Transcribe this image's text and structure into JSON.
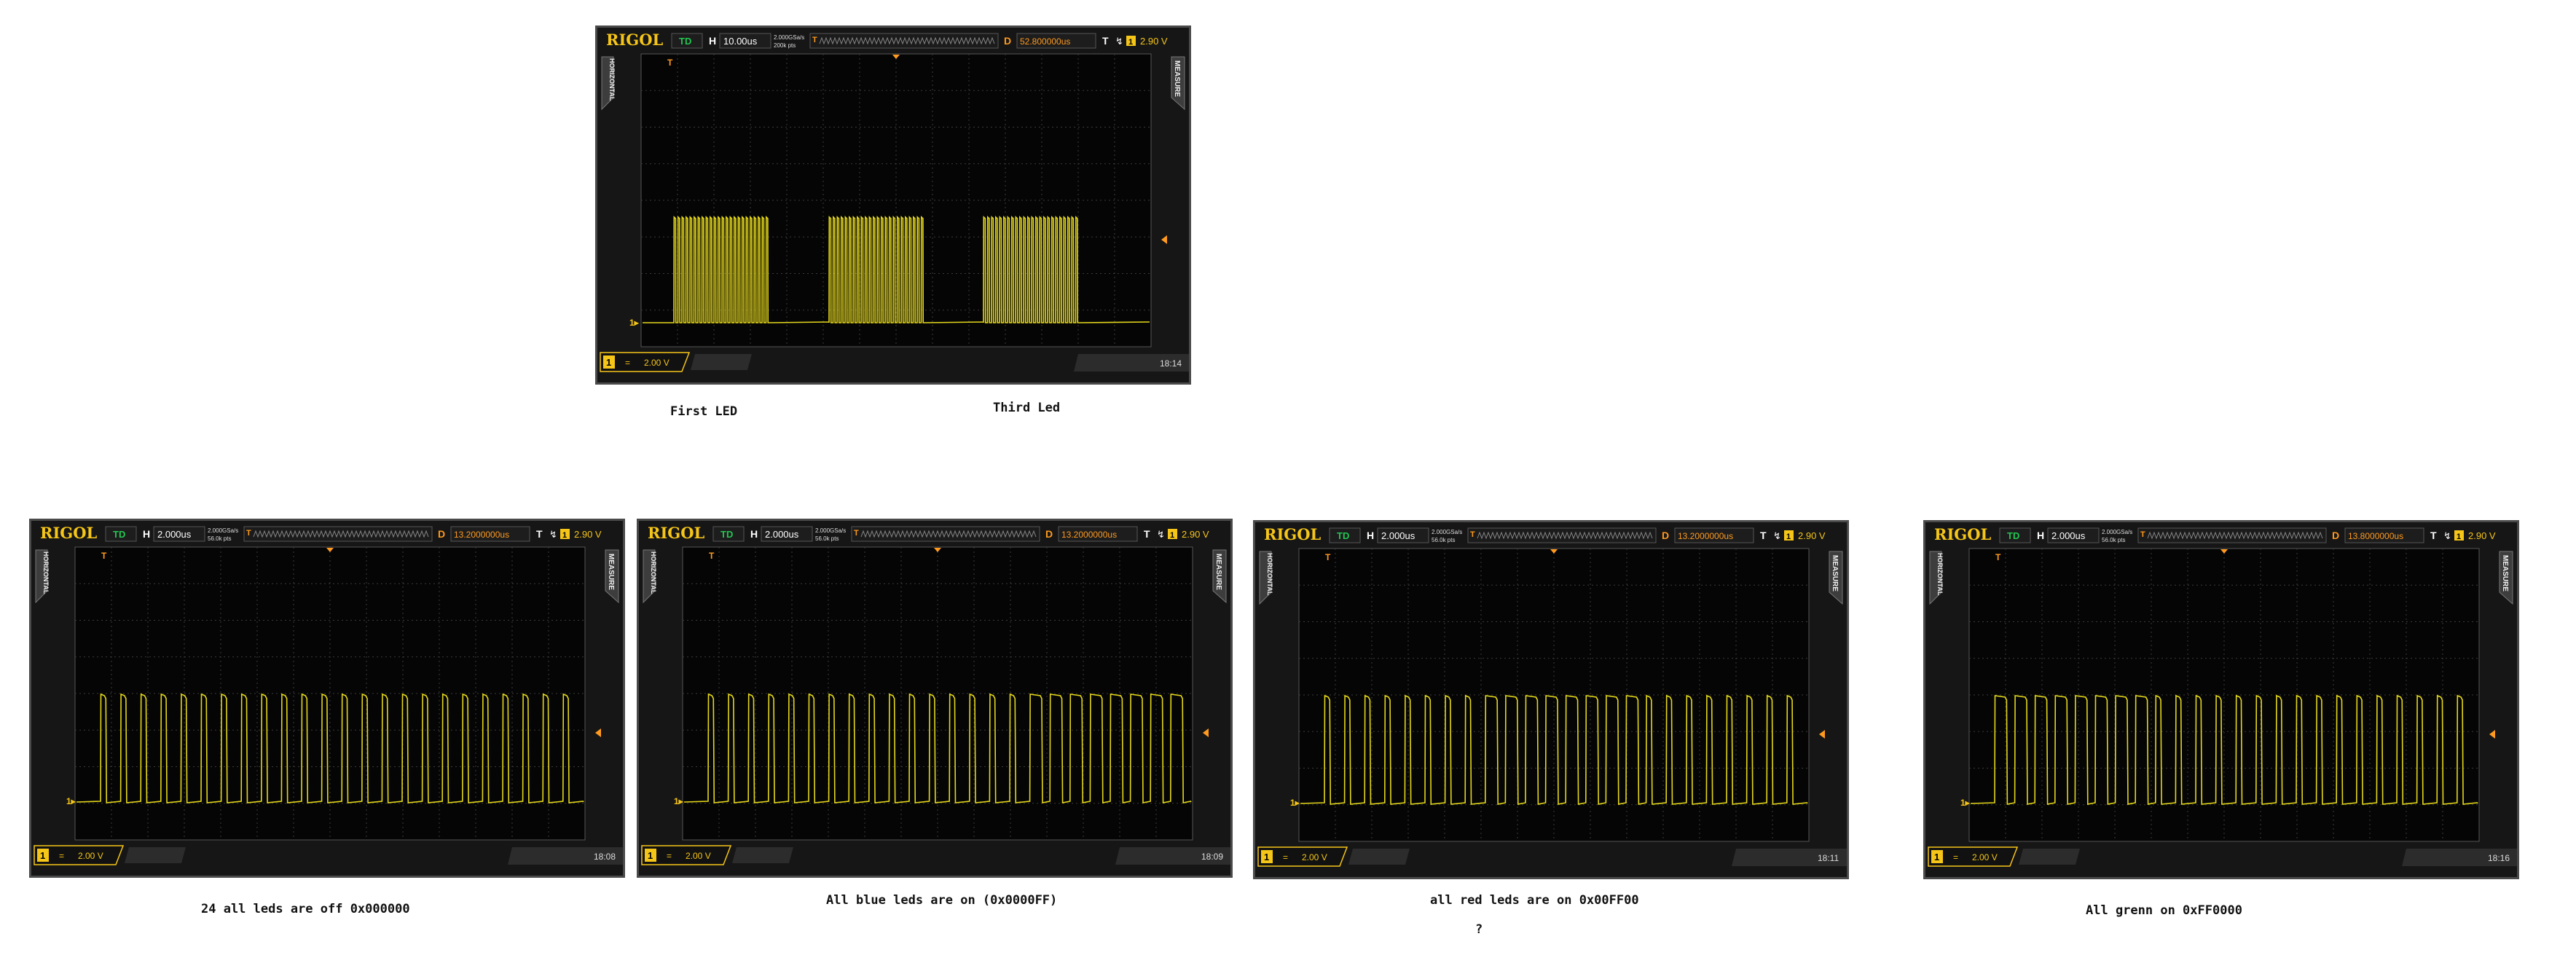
{
  "colors": {
    "trace": "#e5d81b",
    "brand": "#f5c518",
    "td": "#23c552",
    "delay": "#ff9a1f",
    "grid": "#3b3b3b",
    "panel": "#2a2a2a",
    "screen": "#050505"
  },
  "scopes": [
    {
      "brand": "RIGOL",
      "td": "TD",
      "h_label": "H",
      "timebase": "10.00us",
      "sample_rate": "2.000GSa/s",
      "mem_depth": "200k pts",
      "d_label": "D",
      "delay": "52.800000us",
      "t_label": "T",
      "channel": "1",
      "trigger_level": "2.90 V",
      "left_tab": "HORIZONTAL",
      "right_tab": "MEASURE",
      "ch_scale": "2.00 V",
      "ch_marker": "1",
      "coupling": "=",
      "time": "18:14",
      "pattern": "groups",
      "groups": 3,
      "pulses_per_group": 24
    },
    {
      "brand": "RIGOL",
      "td": "TD",
      "h_label": "H",
      "timebase": "2.000us",
      "sample_rate": "2.000GSa/s",
      "mem_depth": "56.0k pts",
      "d_label": "D",
      "delay": "13.2000000us",
      "t_label": "T",
      "channel": "1",
      "trigger_level": "2.90 V",
      "left_tab": "HORIZONTAL",
      "right_tab": "MEASURE",
      "ch_scale": "2.00 V",
      "ch_marker": "1",
      "coupling": "=",
      "time": "18:08",
      "pattern": "bits",
      "bits": "000000000000000000000000"
    },
    {
      "brand": "RIGOL",
      "td": "TD",
      "h_label": "H",
      "timebase": "2.000us",
      "sample_rate": "2.000GSa/s",
      "mem_depth": "56.0k pts",
      "d_label": "D",
      "delay": "13.2000000us",
      "t_label": "T",
      "channel": "1",
      "trigger_level": "2.90 V",
      "left_tab": "HORIZONTAL",
      "right_tab": "MEASURE",
      "ch_scale": "2.00 V",
      "ch_marker": "1",
      "coupling": "=",
      "time": "18:09",
      "pattern": "bits",
      "bits": "000000000000000011111111"
    },
    {
      "brand": "RIGOL",
      "td": "TD",
      "h_label": "H",
      "timebase": "2.000us",
      "sample_rate": "2.000GSa/s",
      "mem_depth": "56.0k pts",
      "d_label": "D",
      "delay": "13.2000000us",
      "t_label": "T",
      "channel": "1",
      "trigger_level": "2.90 V",
      "left_tab": "HORIZONTAL",
      "right_tab": "MEASURE",
      "ch_scale": "2.00 V",
      "ch_marker": "1",
      "coupling": "=",
      "time": "18:11",
      "pattern": "bits",
      "bits": "000000001111111100000000"
    },
    {
      "brand": "RIGOL",
      "td": "TD",
      "h_label": "H",
      "timebase": "2.000us",
      "sample_rate": "2.000GSa/s",
      "mem_depth": "56.0k pts",
      "d_label": "D",
      "delay": "13.8000000us",
      "t_label": "T",
      "channel": "1",
      "trigger_level": "2.90 V",
      "left_tab": "HORIZONTAL",
      "right_tab": "MEASURE",
      "ch_scale": "2.00 V",
      "ch_marker": "1",
      "coupling": "=",
      "time": "18:16",
      "pattern": "bits",
      "bits": "111111110000000000000000"
    }
  ],
  "captions": {
    "first_led": "First LED",
    "third_led": "Third Led",
    "all_off": "24 all leds are off 0x000000",
    "all_blue": "All blue leds are on (0x0000FF)",
    "all_red": "all red leds are on 0x00FF00",
    "question": "?",
    "all_green": "All grenn on 0xFF0000"
  }
}
